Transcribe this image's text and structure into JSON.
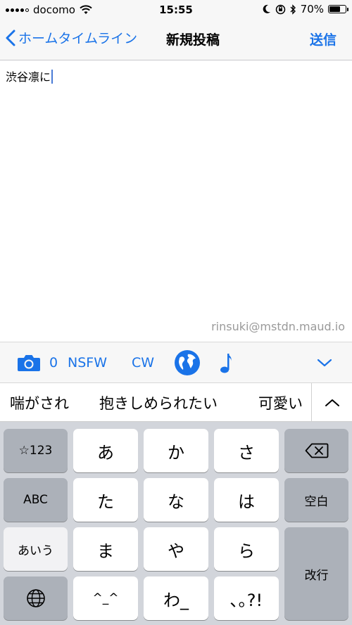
{
  "status_bar": {
    "carrier": "docomo",
    "time": "15:55",
    "battery": "70%",
    "battery_fill": 0.7
  },
  "nav": {
    "back_label": "ホームタイムライン",
    "title": "新規投稿",
    "send_label": "送信"
  },
  "compose": {
    "text": "渋谷凛に",
    "account": "rinsuki@mstdn.maud.io"
  },
  "toolbar": {
    "media_count": "0",
    "nsfw_label": "NSFW",
    "cw_label": "CW"
  },
  "suggestions": [
    "喘がされ",
    "抱きしめられたい",
    "可愛い"
  ],
  "keyboard": {
    "row1": [
      "☆123",
      "あ",
      "か",
      "さ"
    ],
    "row2": [
      "ABC",
      "た",
      "な",
      "は",
      "空白"
    ],
    "row3": [
      "あいう",
      "ま",
      "や",
      "ら",
      "改行"
    ],
    "row4": [
      "^_^",
      "わ_",
      "､｡?!"
    ]
  },
  "colors": {
    "accent": "#1a73e8"
  }
}
